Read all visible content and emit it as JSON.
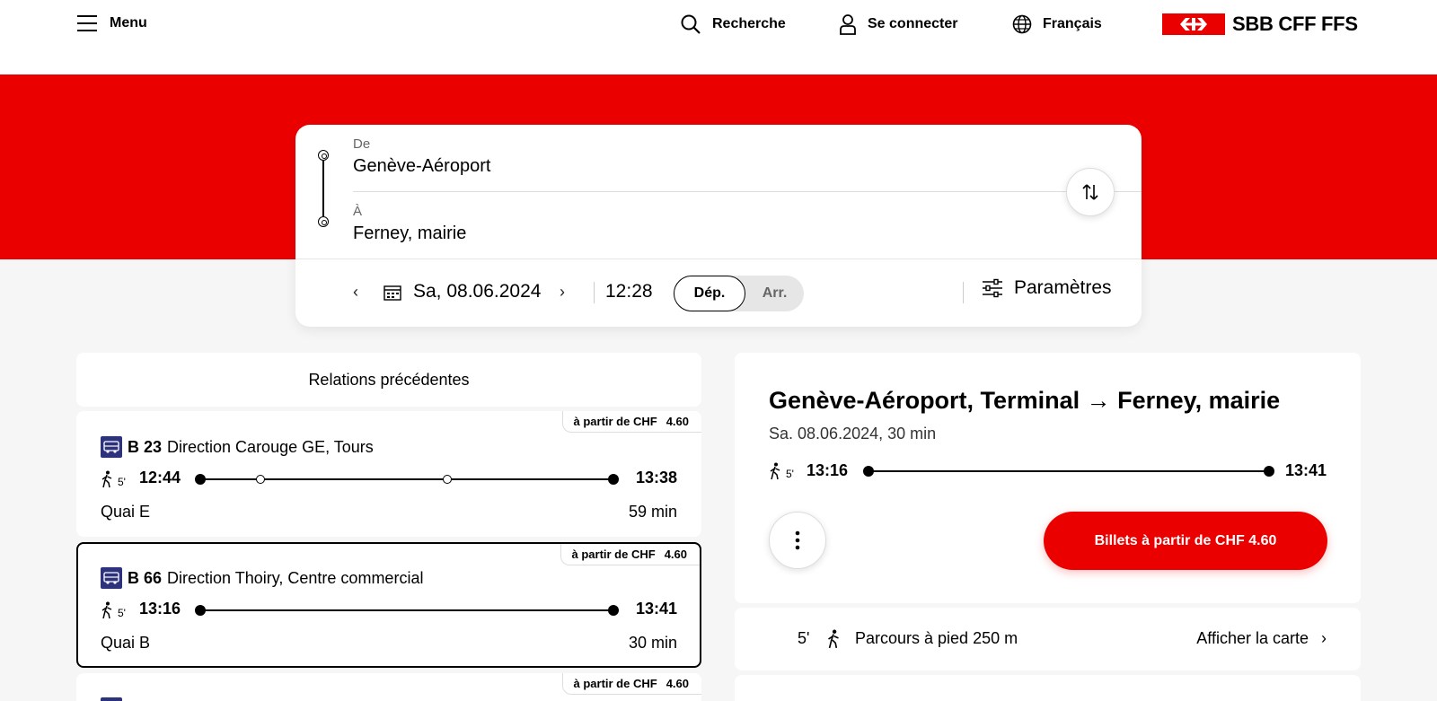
{
  "header": {
    "menu_label": "Menu",
    "search_label": "Recherche",
    "login_label": "Se connecter",
    "language_label": "Français",
    "logo_text": "SBB CFF FFS"
  },
  "search": {
    "from_label": "De",
    "from_value": "Genève-Aéroport",
    "to_label": "À",
    "to_value": "Ferney, mairie",
    "date": "Sa, 08.06.2024",
    "time": "12:28",
    "dep_label": "Dép.",
    "arr_label": "Arr.",
    "params_label": "Paramètres"
  },
  "results": {
    "previous_label": "Relations précédentes",
    "price_prefix": "à partir de CHF",
    "connections": [
      {
        "line": "B 23",
        "direction": "Direction Carouge GE, Tours",
        "walk_min": "5'",
        "dep": "12:44",
        "arr": "13:38",
        "platform": "Quai E",
        "duration": "59 min",
        "price": "4.60"
      },
      {
        "line": "B 66",
        "direction": "Direction Thoiry, Centre commercial",
        "walk_min": "5'",
        "dep": "13:16",
        "arr": "13:41",
        "platform": "Quai B",
        "duration": "30 min",
        "price": "4.60"
      },
      {
        "price": "4.60"
      }
    ]
  },
  "detail": {
    "title": "Genève-Aéroport, Terminal → Ferney, mairie",
    "subtitle": "Sa. 08.06.2024, 30 min",
    "walk_min": "5'",
    "dep": "13:16",
    "arr": "13:41",
    "ticket_label": "Billets à partir de CHF 4.60",
    "walk_row_min": "5'",
    "walk_row_text": "Parcours à pied 250 m",
    "map_link": "Afficher la carte"
  },
  "colors": {
    "brand_red": "#eb0000",
    "bus_blue": "#2d327d"
  }
}
